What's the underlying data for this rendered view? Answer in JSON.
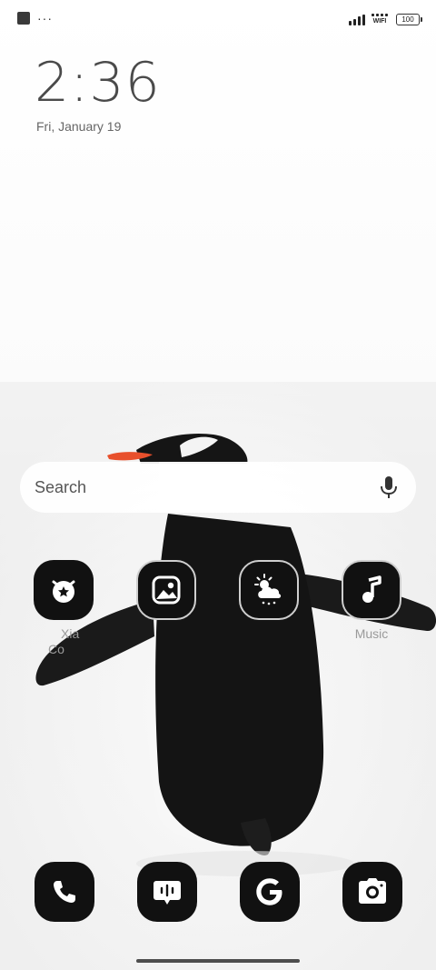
{
  "status_bar": {
    "notification_icons": [
      "square-notification-icon",
      "more-dots-icon"
    ],
    "more_indicator": "···",
    "wifi_label": "WIFI",
    "battery_level": "100"
  },
  "lockscreen": {
    "time": "2:36",
    "date": "Fri, January 19"
  },
  "search": {
    "placeholder": "Search",
    "mic_icon": "microphone-icon"
  },
  "apps": [
    {
      "name": "Xiaomi Community",
      "label_visible": "Xia Co",
      "icon": "mi-community-icon"
    },
    {
      "name": "Gallery",
      "label_visible": "",
      "icon": "gallery-icon"
    },
    {
      "name": "Weather",
      "label_visible": "",
      "icon": "weather-icon"
    },
    {
      "name": "Music",
      "label_visible": "Music",
      "icon": "music-note-icon"
    }
  ],
  "dock": [
    {
      "icon": "phone-icon"
    },
    {
      "icon": "messaging-icon"
    },
    {
      "icon": "google-icon"
    },
    {
      "icon": "camera-icon"
    }
  ],
  "colors": {
    "icon_bg": "#111111",
    "label": "#9a9a9a",
    "penguin_beak": "#e8502c"
  }
}
